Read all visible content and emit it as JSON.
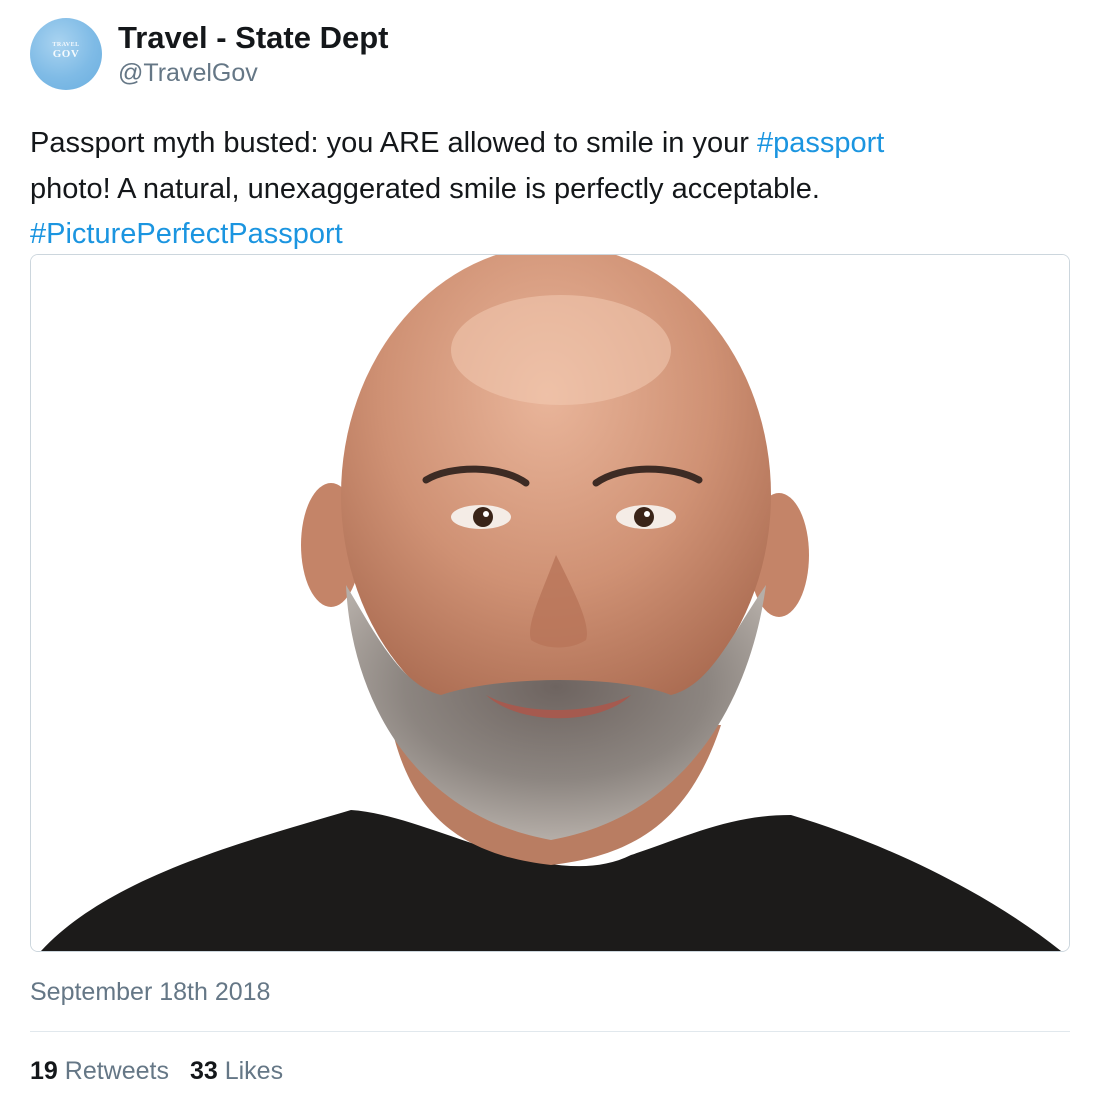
{
  "tweet": {
    "author": {
      "display_name": "Travel - State Dept",
      "handle": "@TravelGov",
      "avatar_text_line1": "TRAVEL",
      "avatar_text_line2": "GOV"
    },
    "text": {
      "line1_prefix": "Passport myth busted: you ARE allowed to smile in your ",
      "hashtag_1": "#passport",
      "line2": "photo! A natural, unexaggerated smile is perfectly acceptable.",
      "hashtag_2": "#PicturePerfectPassport"
    },
    "media": {
      "icon": "passport-photo-image"
    },
    "date": "September 18th 2018",
    "stats": {
      "retweets_count": "19",
      "retweets_label": "Retweets",
      "likes_count": "33",
      "likes_label": "Likes"
    }
  },
  "colors": {
    "text_primary": "#14171a",
    "text_secondary": "#657786",
    "link": "#1b95e0",
    "border": "#ccd6dd",
    "divider": "#e1e8ed",
    "avatar_bg": "#7fbbe6"
  }
}
